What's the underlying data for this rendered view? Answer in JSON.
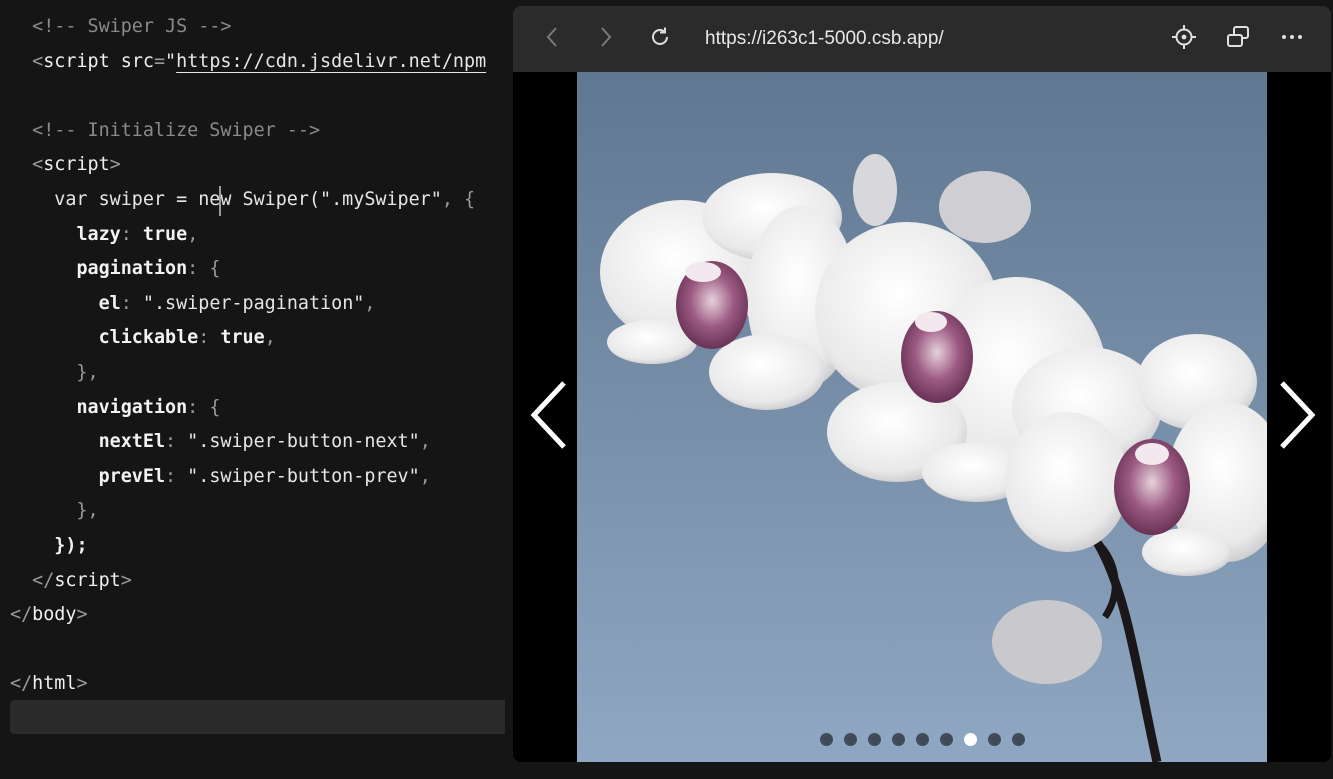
{
  "editor": {
    "lines": [
      [
        {
          "t": "  <!-- Swiper JS -->",
          "c": "tk-comment"
        }
      ],
      [
        {
          "t": "  ",
          "c": "tk-plain"
        },
        {
          "t": "<",
          "c": "tk-punct"
        },
        {
          "t": "script",
          "c": "tk-tag"
        },
        {
          "t": " src",
          "c": "tk-attr"
        },
        {
          "t": "=",
          "c": "tk-punct"
        },
        {
          "t": "\"",
          "c": "tk-string"
        },
        {
          "t": "https://cdn.jsdelivr.net/npm",
          "c": "tk-url"
        }
      ],
      [],
      [
        {
          "t": "  <!-- Initialize Swiper -->",
          "c": "tk-comment"
        }
      ],
      [
        {
          "t": "  ",
          "c": "tk-plain"
        },
        {
          "t": "<",
          "c": "tk-punct"
        },
        {
          "t": "script",
          "c": "tk-tag"
        },
        {
          "t": ">",
          "c": "tk-punct"
        }
      ],
      [
        {
          "t": "    var swiper = new Swiper(",
          "c": "tk-plain"
        },
        {
          "t": "\".mySwiper\"",
          "c": "tk-string"
        },
        {
          "t": ", {",
          "c": "tk-punct"
        }
      ],
      [
        {
          "t": "      ",
          "c": "tk-plain"
        },
        {
          "t": "lazy",
          "c": "tk-prop"
        },
        {
          "t": ": ",
          "c": "tk-punct"
        },
        {
          "t": "true",
          "c": "tk-bool"
        },
        {
          "t": ",",
          "c": "tk-punct"
        }
      ],
      [
        {
          "t": "      ",
          "c": "tk-plain"
        },
        {
          "t": "pagination",
          "c": "tk-prop"
        },
        {
          "t": ": {",
          "c": "tk-punct"
        }
      ],
      [
        {
          "t": "        ",
          "c": "tk-plain"
        },
        {
          "t": "el",
          "c": "tk-prop"
        },
        {
          "t": ": ",
          "c": "tk-punct"
        },
        {
          "t": "\".swiper-pagination\"",
          "c": "tk-string"
        },
        {
          "t": ",",
          "c": "tk-punct"
        }
      ],
      [
        {
          "t": "        ",
          "c": "tk-plain"
        },
        {
          "t": "clickable",
          "c": "tk-prop"
        },
        {
          "t": ": ",
          "c": "tk-punct"
        },
        {
          "t": "true",
          "c": "tk-bool"
        },
        {
          "t": ",",
          "c": "tk-punct"
        }
      ],
      [
        {
          "t": "      },",
          "c": "tk-punct"
        }
      ],
      [
        {
          "t": "      ",
          "c": "tk-plain"
        },
        {
          "t": "navigation",
          "c": "tk-prop"
        },
        {
          "t": ": {",
          "c": "tk-punct"
        }
      ],
      [
        {
          "t": "        ",
          "c": "tk-plain"
        },
        {
          "t": "nextEl",
          "c": "tk-prop"
        },
        {
          "t": ": ",
          "c": "tk-punct"
        },
        {
          "t": "\".swiper-button-next\"",
          "c": "tk-string"
        },
        {
          "t": ",",
          "c": "tk-punct"
        }
      ],
      [
        {
          "t": "        ",
          "c": "tk-plain"
        },
        {
          "t": "prevEl",
          "c": "tk-prop"
        },
        {
          "t": ": ",
          "c": "tk-punct"
        },
        {
          "t": "\".swiper-button-prev\"",
          "c": "tk-string"
        },
        {
          "t": ",",
          "c": "tk-punct"
        }
      ],
      [
        {
          "t": "      },",
          "c": "tk-punct"
        }
      ],
      [
        {
          "t": "    ",
          "c": "tk-plain"
        },
        {
          "t": "});",
          "c": "tk-bool"
        }
      ],
      [
        {
          "t": "  ",
          "c": "tk-plain"
        },
        {
          "t": "</",
          "c": "tk-punct"
        },
        {
          "t": "script",
          "c": "tk-tag"
        },
        {
          "t": ">",
          "c": "tk-punct"
        }
      ],
      [
        {
          "t": "</",
          "c": "tk-punct"
        },
        {
          "t": "body",
          "c": "tk-tag"
        },
        {
          "t": ">",
          "c": "tk-punct"
        }
      ],
      [],
      [
        {
          "t": "</",
          "c": "tk-punct"
        },
        {
          "t": "html",
          "c": "tk-tag"
        },
        {
          "t": ">",
          "c": "tk-punct"
        }
      ]
    ]
  },
  "browser": {
    "url": "https://i263c1-5000.csb.app/",
    "icons": {
      "back": "chevron-left-icon",
      "forward": "chevron-right-icon",
      "reload": "reload-icon",
      "inspect": "crosshair-icon",
      "open_window": "open-new-window-icon",
      "more": "more-horizontal-icon"
    }
  },
  "slider": {
    "slide_count": 9,
    "active_index": 6,
    "image_subject": "white-pink-orchid-photo",
    "colors": {
      "sky_top": "#5f7790",
      "sky_bottom": "#8fa7c2",
      "dot_inactive": "#3f4b58",
      "dot_active": "#ffffff"
    }
  }
}
